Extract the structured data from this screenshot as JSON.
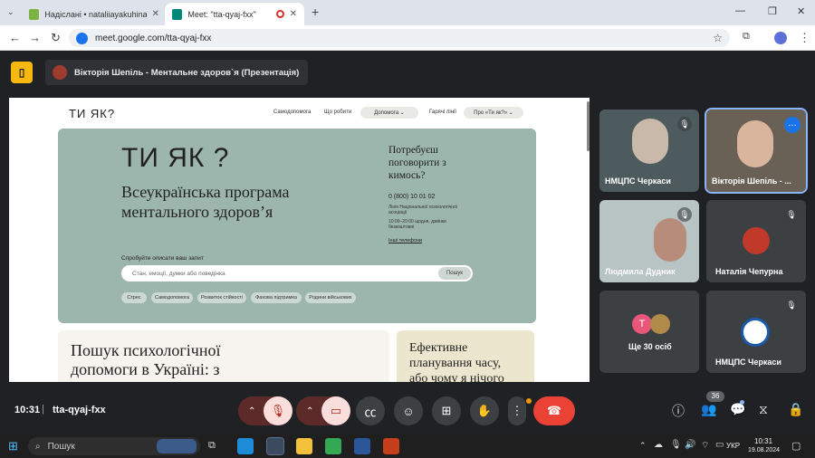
{
  "browser": {
    "tabs": [
      {
        "title": "Надіслані • nataliiayakuhina@",
        "active": false
      },
      {
        "title": "Meet: \"tta-qyaj-fxx\"",
        "active": true
      }
    ],
    "new_tab": "+",
    "url": "meet.google.com/tta-qyaj-fxx",
    "window_controls": [
      "—",
      "❐",
      "✕"
    ]
  },
  "meet": {
    "presenter_title": "Вікторія Шепіль - Ментальне здоров`я (Презентація)",
    "time": "10:31",
    "meeting_code": "tta-qyaj-fxx",
    "participant_count": "36"
  },
  "website": {
    "logo": "ТИ ЯК?",
    "nav": [
      "Самодопомога",
      "Що робити",
      "Допомога",
      "Гарячі лінії",
      "Про «Ти як?»"
    ],
    "hero_logo": "ТИ ЯК ?",
    "hero_title_line1": "Всеукраїнська програма",
    "hero_title_line2": "ментального здоров’я",
    "talk_title_line1": "Потребуєш",
    "talk_title_line2": "поговорити з",
    "talk_title_line3": "кимось?",
    "phone": "0 (800) 10 01 02",
    "phone_desc_line1": "Лінія Національної психологічної",
    "phone_desc_line2": "асоціації",
    "hours_line1": "10:00–20:00 щодня, дзвінки",
    "hours_line2": "безкоштовні",
    "hotlines_link": "Інші телефони",
    "search_label": "Спробуйте описати ваш запит",
    "search_placeholder": "Стан, емоції, думки або поведінка",
    "search_button": "Пошук",
    "chips": [
      "Стрес",
      "Самодопомога",
      "Розвиток стійкості",
      "Фахова підтримка",
      "Родини військових"
    ],
    "card1_line1": "Пошук психологічної",
    "card1_line2": "допомоги в Україні: з",
    "card2_line1": "Ефективне",
    "card2_line2": "планування часу,",
    "card2_line3": "або чому я нічого"
  },
  "participants": [
    {
      "name": "НМЦПС Черкаси",
      "muted": true
    },
    {
      "name": "Вікторія Шепіль - ...",
      "muted": false
    },
    {
      "name": "Людмила Дудник",
      "muted": true
    },
    {
      "name": "Наталія Чепурна",
      "muted": true
    },
    {
      "name": "Ще 30 осіб",
      "initial": "Т"
    },
    {
      "name": "НМЦПС Черкаси",
      "muted": true
    }
  ],
  "taskbar": {
    "search": "Пошук",
    "lang": "УКР",
    "clock_time": "10:31",
    "clock_date": "19.08.2024"
  },
  "colors": {
    "accent_yellow": "#f7b812",
    "end_call": "#ea4335",
    "mute_bg": "#f9dedc",
    "hero": "#9cb5ad"
  }
}
